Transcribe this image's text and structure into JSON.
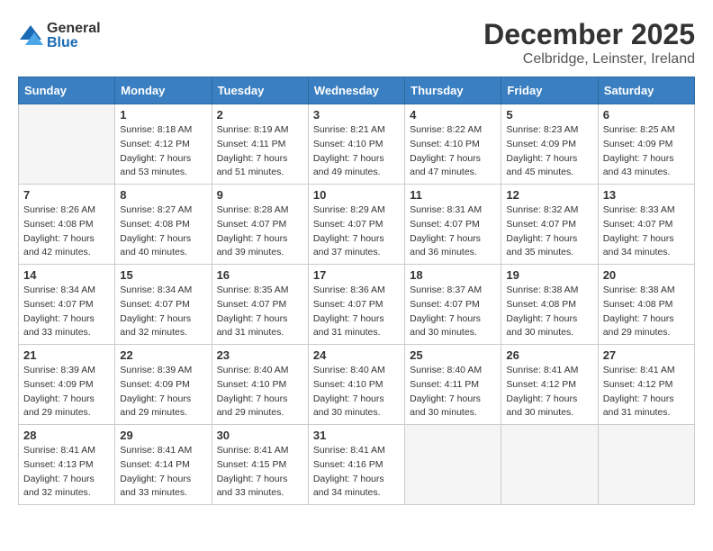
{
  "header": {
    "logo_general": "General",
    "logo_blue": "Blue",
    "month": "December 2025",
    "location": "Celbridge, Leinster, Ireland"
  },
  "days_of_week": [
    "Sunday",
    "Monday",
    "Tuesday",
    "Wednesday",
    "Thursday",
    "Friday",
    "Saturday"
  ],
  "weeks": [
    [
      {
        "day": "",
        "sunrise": "",
        "sunset": "",
        "daylight": "",
        "empty": true
      },
      {
        "day": "1",
        "sunrise": "8:18 AM",
        "sunset": "4:12 PM",
        "daylight": "7 hours and 53 minutes."
      },
      {
        "day": "2",
        "sunrise": "8:19 AM",
        "sunset": "4:11 PM",
        "daylight": "7 hours and 51 minutes."
      },
      {
        "day": "3",
        "sunrise": "8:21 AM",
        "sunset": "4:10 PM",
        "daylight": "7 hours and 49 minutes."
      },
      {
        "day": "4",
        "sunrise": "8:22 AM",
        "sunset": "4:10 PM",
        "daylight": "7 hours and 47 minutes."
      },
      {
        "day": "5",
        "sunrise": "8:23 AM",
        "sunset": "4:09 PM",
        "daylight": "7 hours and 45 minutes."
      },
      {
        "day": "6",
        "sunrise": "8:25 AM",
        "sunset": "4:09 PM",
        "daylight": "7 hours and 43 minutes."
      }
    ],
    [
      {
        "day": "7",
        "sunrise": "8:26 AM",
        "sunset": "4:08 PM",
        "daylight": "7 hours and 42 minutes."
      },
      {
        "day": "8",
        "sunrise": "8:27 AM",
        "sunset": "4:08 PM",
        "daylight": "7 hours and 40 minutes."
      },
      {
        "day": "9",
        "sunrise": "8:28 AM",
        "sunset": "4:07 PM",
        "daylight": "7 hours and 39 minutes."
      },
      {
        "day": "10",
        "sunrise": "8:29 AM",
        "sunset": "4:07 PM",
        "daylight": "7 hours and 37 minutes."
      },
      {
        "day": "11",
        "sunrise": "8:31 AM",
        "sunset": "4:07 PM",
        "daylight": "7 hours and 36 minutes."
      },
      {
        "day": "12",
        "sunrise": "8:32 AM",
        "sunset": "4:07 PM",
        "daylight": "7 hours and 35 minutes."
      },
      {
        "day": "13",
        "sunrise": "8:33 AM",
        "sunset": "4:07 PM",
        "daylight": "7 hours and 34 minutes."
      }
    ],
    [
      {
        "day": "14",
        "sunrise": "8:34 AM",
        "sunset": "4:07 PM",
        "daylight": "7 hours and 33 minutes."
      },
      {
        "day": "15",
        "sunrise": "8:34 AM",
        "sunset": "4:07 PM",
        "daylight": "7 hours and 32 minutes."
      },
      {
        "day": "16",
        "sunrise": "8:35 AM",
        "sunset": "4:07 PM",
        "daylight": "7 hours and 31 minutes."
      },
      {
        "day": "17",
        "sunrise": "8:36 AM",
        "sunset": "4:07 PM",
        "daylight": "7 hours and 31 minutes."
      },
      {
        "day": "18",
        "sunrise": "8:37 AM",
        "sunset": "4:07 PM",
        "daylight": "7 hours and 30 minutes."
      },
      {
        "day": "19",
        "sunrise": "8:38 AM",
        "sunset": "4:08 PM",
        "daylight": "7 hours and 30 minutes."
      },
      {
        "day": "20",
        "sunrise": "8:38 AM",
        "sunset": "4:08 PM",
        "daylight": "7 hours and 29 minutes."
      }
    ],
    [
      {
        "day": "21",
        "sunrise": "8:39 AM",
        "sunset": "4:09 PM",
        "daylight": "7 hours and 29 minutes."
      },
      {
        "day": "22",
        "sunrise": "8:39 AM",
        "sunset": "4:09 PM",
        "daylight": "7 hours and 29 minutes."
      },
      {
        "day": "23",
        "sunrise": "8:40 AM",
        "sunset": "4:10 PM",
        "daylight": "7 hours and 29 minutes."
      },
      {
        "day": "24",
        "sunrise": "8:40 AM",
        "sunset": "4:10 PM",
        "daylight": "7 hours and 30 minutes."
      },
      {
        "day": "25",
        "sunrise": "8:40 AM",
        "sunset": "4:11 PM",
        "daylight": "7 hours and 30 minutes."
      },
      {
        "day": "26",
        "sunrise": "8:41 AM",
        "sunset": "4:12 PM",
        "daylight": "7 hours and 30 minutes."
      },
      {
        "day": "27",
        "sunrise": "8:41 AM",
        "sunset": "4:12 PM",
        "daylight": "7 hours and 31 minutes."
      }
    ],
    [
      {
        "day": "28",
        "sunrise": "8:41 AM",
        "sunset": "4:13 PM",
        "daylight": "7 hours and 32 minutes."
      },
      {
        "day": "29",
        "sunrise": "8:41 AM",
        "sunset": "4:14 PM",
        "daylight": "7 hours and 33 minutes."
      },
      {
        "day": "30",
        "sunrise": "8:41 AM",
        "sunset": "4:15 PM",
        "daylight": "7 hours and 33 minutes."
      },
      {
        "day": "31",
        "sunrise": "8:41 AM",
        "sunset": "4:16 PM",
        "daylight": "7 hours and 34 minutes."
      },
      {
        "day": "",
        "sunrise": "",
        "sunset": "",
        "daylight": "",
        "empty": true
      },
      {
        "day": "",
        "sunrise": "",
        "sunset": "",
        "daylight": "",
        "empty": true
      },
      {
        "day": "",
        "sunrise": "",
        "sunset": "",
        "daylight": "",
        "empty": true
      }
    ]
  ]
}
